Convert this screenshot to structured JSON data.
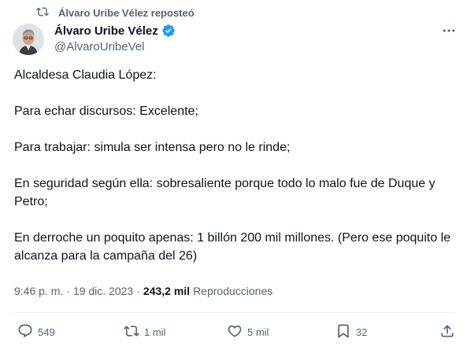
{
  "repost": {
    "label": "Álvaro Uribe Vélez reposteó"
  },
  "author": {
    "display_name": "Álvaro Uribe Vélez",
    "handle": "@AlvaroUribeVel",
    "verified": true,
    "verified_color": "#1d9bf0"
  },
  "tweet": {
    "paragraphs": [
      "Alcaldesa Claudia López:",
      "Para echar discursos: Excelente;",
      "Para trabajar: simula ser intensa pero no le rinde;",
      "En seguridad según ella: sobresaliente porque todo lo malo fue de Duque y Petro;",
      "En derroche un poquito apenas: 1 billón 200 mil millones. (Pero ese poquito le alcanza para la campaña del 26)"
    ],
    "time": "9:46 p. m.",
    "separator": "·",
    "date": "19 dic. 2023",
    "views_count": "243,2 mil",
    "views_label": "Reproducciones"
  },
  "actions": {
    "replies": "549",
    "reposts": "1 mil",
    "likes": "5 mil",
    "bookmarks": "32"
  },
  "icons": {
    "repost": "repost-icon",
    "verified": "verified-badge-icon",
    "more": "more-options-icon",
    "reply": "reply-icon",
    "like": "heart-icon",
    "bookmark": "bookmark-icon",
    "share": "share-icon"
  },
  "colors": {
    "text_primary": "#0f1419",
    "text_secondary": "#536471",
    "accent": "#1d9bf0"
  }
}
